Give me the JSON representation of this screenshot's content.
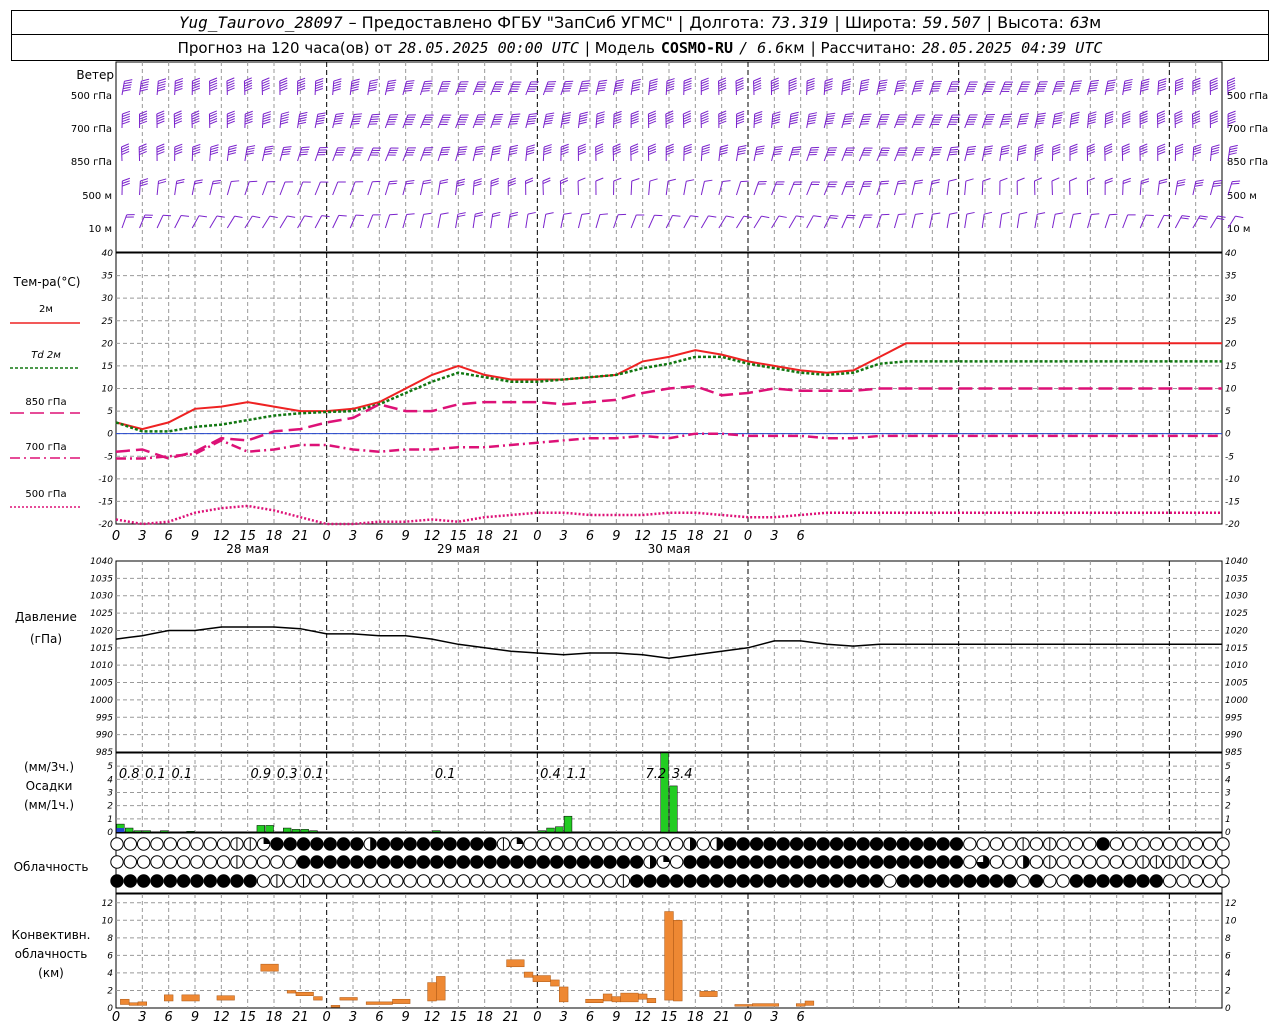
{
  "header": {
    "station": "Yug_Taurovo_28097",
    "provider_text": "– Предоставлено ФГБУ \"ЗапСиб УГМС\" |",
    "lon_label": "Долгота:",
    "lon_value": "73.319",
    "lat_label": "| Широта:",
    "lat_value": "59.507",
    "alt_label": "| Высота:",
    "alt_value": "63",
    "alt_unit": "м",
    "forecast_label": "Прогноз на 120 часа(ов) от",
    "forecast_start": "28.05.2025 00:00 UTC",
    "model_label": "| Модель",
    "model_name": "COSMO-RU",
    "model_res": "/ 6.6",
    "model_res_unit": "км",
    "calc_label": "| Рассчитано:",
    "calc_time": "28.05.2025 04:39 UTC"
  },
  "labels": {
    "wind": "Ветер",
    "wind_levels": [
      "500 гПа",
      "700 гПа",
      "850 гПа",
      "500 м",
      "10 м"
    ],
    "temp_title": "Тем-ра(°С)",
    "temp_series": [
      {
        "name": "2м",
        "color": "#ee2222",
        "dash": ""
      },
      {
        "name": "Td  2м",
        "color": "#117711",
        "dash": "3,2"
      },
      {
        "name": "850 гПа",
        "color": "#dd1177",
        "dash": "14,6"
      },
      {
        "name": "700 гПа",
        "color": "#dd1177",
        "dash": "10,4,2,4"
      },
      {
        "name": "500 гПа",
        "color": "#dd1177",
        "dash": "2,2"
      }
    ],
    "pressure_title": "Давление",
    "pressure_unit": "(гПа)",
    "precip_unit_top": "(мм/3ч.)",
    "precip_title": "Осадки",
    "precip_unit_bottom": "(мм/1ч.)",
    "cloud_title": "Облачность",
    "conv_title_1": "Конвективн.",
    "conv_title_2": "облачность",
    "conv_unit": "(км)"
  },
  "chart_data": [
    {
      "type": "line",
      "panel": "temperature",
      "x_hours": [
        0,
        3,
        6,
        9,
        12,
        15,
        18,
        21,
        24,
        27,
        30,
        33,
        36,
        39,
        42,
        45,
        48,
        51,
        54,
        57,
        60,
        63,
        66,
        69,
        72,
        75,
        78,
        81,
        84,
        87,
        90,
        93,
        96,
        99,
        102,
        105,
        108,
        111,
        114,
        117,
        120,
        123,
        126
      ],
      "x_tick_labels": [
        "0",
        "3",
        "6",
        "9",
        "12",
        "15",
        "18",
        "21",
        "0",
        "3",
        "6",
        "9",
        "12",
        "15",
        "18",
        "21",
        "0",
        "3",
        "6",
        "9",
        "12",
        "15",
        "18",
        "21",
        "0",
        "3",
        "6"
      ],
      "date_labels": [
        {
          "hour": 15,
          "text": "28 мая"
        },
        {
          "hour": 39,
          "text": "29 мая"
        },
        {
          "hour": 63,
          "text": "30 мая"
        }
      ],
      "ylim": [
        -20,
        40
      ],
      "yticks": [
        -20,
        -15,
        -10,
        -5,
        0,
        5,
        10,
        15,
        20,
        25,
        30,
        35,
        40
      ],
      "series": [
        {
          "name": "2м",
          "values": [
            2.5,
            1.0,
            2.5,
            5.5,
            6.0,
            7.0,
            6.0,
            5.0,
            5.0,
            5.5,
            7.0,
            10.0,
            13.0,
            15.0,
            13.0,
            12.0,
            12.0,
            12.0,
            12.5,
            13.0,
            16.0,
            17.0,
            18.5,
            17.5,
            16.0,
            15.0,
            14.0,
            13.5,
            14.0,
            17.0,
            20.0,
            20.0,
            20.0,
            20.0,
            20.0,
            20.0,
            20.0,
            20.0,
            20.0,
            20.0,
            20.0,
            20.0,
            20.0
          ]
        },
        {
          "name": "Td  2м",
          "values": [
            2.5,
            0.5,
            0.5,
            1.5,
            2.0,
            3.0,
            4.0,
            4.5,
            4.8,
            5.0,
            6.5,
            9.0,
            11.5,
            13.5,
            12.5,
            11.5,
            11.5,
            12.0,
            12.5,
            13.0,
            14.5,
            15.5,
            17.0,
            17.0,
            15.5,
            14.5,
            13.5,
            13.0,
            13.5,
            15.5,
            16.0,
            16.0,
            16.0,
            16.0,
            16.0,
            16.0,
            16.0,
            16.0,
            16.0,
            16.0,
            16.0,
            16.0,
            16.0
          ]
        },
        {
          "name": "850 гПа",
          "values": [
            -4.0,
            -3.5,
            -5.5,
            -4.0,
            -1.0,
            -1.5,
            0.5,
            1.0,
            2.5,
            3.5,
            6.5,
            5.0,
            5.0,
            6.5,
            7.0,
            7.0,
            7.0,
            6.5,
            7.0,
            7.5,
            9.0,
            10.0,
            10.5,
            8.5,
            9.0,
            10.0,
            9.5,
            9.5,
            9.5,
            10.0,
            10.0,
            10.0,
            10.0,
            10.0,
            10.0,
            10.0,
            10.0,
            10.0,
            10.0,
            10.0,
            10.0,
            10.0,
            10.0
          ]
        },
        {
          "name": "700 гПа",
          "values": [
            -5.5,
            -5.5,
            -5.0,
            -4.5,
            -1.5,
            -4.0,
            -3.5,
            -2.5,
            -2.5,
            -3.5,
            -4.0,
            -3.5,
            -3.5,
            -3.0,
            -3.0,
            -2.5,
            -2.0,
            -1.5,
            -1.0,
            -1.0,
            -0.5,
            -1.0,
            0.0,
            0.0,
            -0.5,
            -0.5,
            -0.5,
            -1.0,
            -1.0,
            -0.5,
            -0.5,
            -0.5,
            -0.5,
            -0.5,
            -0.5,
            -0.5,
            -0.5,
            -0.5,
            -0.5,
            -0.5,
            -0.5,
            -0.5,
            -0.5
          ]
        },
        {
          "name": "500 гПа",
          "values": [
            -19.0,
            -20.5,
            -19.5,
            -17.5,
            -16.5,
            -16.0,
            -17.0,
            -18.5,
            -20.5,
            -20.5,
            -19.5,
            -19.5,
            -19.0,
            -19.5,
            -18.5,
            -18.0,
            -17.5,
            -17.5,
            -18.0,
            -18.0,
            -18.0,
            -17.5,
            -17.5,
            -18.0,
            -18.5,
            -18.5,
            -18.0,
            -17.5,
            -17.5,
            -17.5,
            -17.5,
            -17.5,
            -17.5,
            -17.5,
            -17.5,
            -17.5,
            -17.5,
            -17.5,
            -17.5,
            -17.5,
            -17.5,
            -17.5,
            -17.5
          ]
        }
      ]
    },
    {
      "type": "line",
      "panel": "pressure",
      "ylim": [
        985,
        1040
      ],
      "yticks": [
        985,
        990,
        995,
        1000,
        1005,
        1010,
        1015,
        1020,
        1025,
        1030,
        1035,
        1040
      ],
      "series": [
        {
          "name": "Давление",
          "values": [
            1017.5,
            1018.5,
            1020.0,
            1020.0,
            1021.0,
            1021.0,
            1021.0,
            1020.5,
            1019.0,
            1019.0,
            1018.5,
            1018.5,
            1017.5,
            1016.0,
            1015.0,
            1014.0,
            1013.5,
            1013.0,
            1013.5,
            1013.5,
            1013.0,
            1012.0,
            1013.0,
            1014.0,
            1015.0,
            1017.0,
            1017.0,
            1016.0,
            1015.5,
            1016.0,
            1016.0,
            1016.0,
            1016.0,
            1016.0,
            1016.0,
            1016.0,
            1016.0,
            1016.0,
            1016.0,
            1016.0,
            1016.0,
            1016.0,
            1016.0
          ]
        }
      ]
    },
    {
      "type": "bar",
      "panel": "precipitation",
      "ylim": [
        0,
        6
      ],
      "yticks": [
        0,
        1,
        2,
        3,
        4,
        5
      ],
      "bars_hourly": [
        {
          "hour": 0.5,
          "value": 0.6
        },
        {
          "hour": 1.5,
          "value": 0.3
        },
        {
          "hour": 2.5,
          "value": 0.1
        },
        {
          "hour": 3.5,
          "value": 0.1
        },
        {
          "hour": 5.5,
          "value": 0.1
        },
        {
          "hour": 8.5,
          "value": 0.05
        },
        {
          "hour": 16.5,
          "value": 0.5
        },
        {
          "hour": 17.5,
          "value": 0.5
        },
        {
          "hour": 19.5,
          "value": 0.3
        },
        {
          "hour": 20.5,
          "value": 0.2
        },
        {
          "hour": 21.5,
          "value": 0.2
        },
        {
          "hour": 22.5,
          "value": 0.1
        },
        {
          "hour": 36.5,
          "value": 0.1
        },
        {
          "hour": 48.5,
          "value": 0.1
        },
        {
          "hour": 49.5,
          "value": 0.3
        },
        {
          "hour": 50.5,
          "value": 0.4
        },
        {
          "hour": 51.5,
          "value": 1.2
        },
        {
          "hour": 62.5,
          "value": 6.0
        },
        {
          "hour": 63.5,
          "value": 3.5
        }
      ],
      "totals_3h": [
        {
          "hour": 1.5,
          "text": "0.8"
        },
        {
          "hour": 4.5,
          "text": "0.1"
        },
        {
          "hour": 7.5,
          "text": "0.1"
        },
        {
          "hour": 16.5,
          "text": "0.9"
        },
        {
          "hour": 19.5,
          "text": "0.3"
        },
        {
          "hour": 22.5,
          "text": "0.1"
        },
        {
          "hour": 37.5,
          "text": "0.1"
        },
        {
          "hour": 49.5,
          "text": "0.4"
        },
        {
          "hour": 52.5,
          "text": "1.1"
        },
        {
          "hour": 61.5,
          "text": "7.2"
        },
        {
          "hour": 64.5,
          "text": "3.4"
        }
      ]
    },
    {
      "type": "table",
      "panel": "cloudiness",
      "layers": [
        "high",
        "medium",
        "low"
      ],
      "rows_cover_0_8": [
        "000000000112888888848888888881200000000000040488888888888888888800001010008000000000",
        "000000000100008888888888888888888888888842088888888888888888888806004010000001111000",
        "888888888880101000000000000000000000001888888888888888888808888888880800888888800000"
      ]
    },
    {
      "type": "bar",
      "panel": "convective_cloud",
      "ylim": [
        0,
        13
      ],
      "yticks": [
        0,
        2,
        4,
        6,
        8,
        10,
        12
      ],
      "bars": [
        {
          "from": 0.5,
          "to": 1.5,
          "top": 1.0,
          "base": 0.4
        },
        {
          "from": 1.5,
          "to": 2.5,
          "top": 0.6,
          "base": 0.3
        },
        {
          "from": 2.5,
          "to": 3.5,
          "top": 0.7,
          "base": 0.3
        },
        {
          "from": 5.5,
          "to": 6.5,
          "top": 1.5,
          "base": 0.8
        },
        {
          "from": 7.5,
          "to": 9.5,
          "top": 1.5,
          "base": 0.8
        },
        {
          "from": 11.5,
          "to": 13.5,
          "top": 1.4,
          "base": 0.9
        },
        {
          "from": 16.5,
          "to": 18.5,
          "top": 5.0,
          "base": 4.2
        },
        {
          "from": 19.5,
          "to": 20.5,
          "top": 2.0,
          "base": 1.7
        },
        {
          "from": 20.5,
          "to": 22.5,
          "top": 1.8,
          "base": 1.4
        },
        {
          "from": 22.5,
          "to": 23.5,
          "top": 1.3,
          "base": 0.9
        },
        {
          "from": 24.5,
          "to": 25.5,
          "top": 0.3,
          "base": 0.1
        },
        {
          "from": 25.5,
          "to": 27.5,
          "top": 1.2,
          "base": 0.9
        },
        {
          "from": 28.5,
          "to": 31.5,
          "top": 0.7,
          "base": 0.4
        },
        {
          "from": 31.5,
          "to": 33.5,
          "top": 1.0,
          "base": 0.5
        },
        {
          "from": 35.5,
          "to": 36.5,
          "top": 2.9,
          "base": 0.8
        },
        {
          "from": 36.5,
          "to": 37.5,
          "top": 3.6,
          "base": 0.9
        },
        {
          "from": 44.5,
          "to": 46.5,
          "top": 5.5,
          "base": 4.7
        },
        {
          "from": 46.5,
          "to": 47.5,
          "top": 4.1,
          "base": 3.5
        },
        {
          "from": 47.5,
          "to": 49.5,
          "top": 3.7,
          "base": 3.0
        },
        {
          "from": 49.5,
          "to": 50.5,
          "top": 3.2,
          "base": 2.5
        },
        {
          "from": 50.5,
          "to": 51.5,
          "top": 2.4,
          "base": 0.7
        },
        {
          "from": 53.5,
          "to": 55.5,
          "top": 1.0,
          "base": 0.6
        },
        {
          "from": 55.5,
          "to": 56.5,
          "top": 1.6,
          "base": 0.8
        },
        {
          "from": 56.5,
          "to": 57.5,
          "top": 1.3,
          "base": 0.7
        },
        {
          "from": 57.5,
          "to": 59.5,
          "top": 1.7,
          "base": 0.7
        },
        {
          "from": 59.5,
          "to": 60.5,
          "top": 1.6,
          "base": 1.0
        },
        {
          "from": 60.5,
          "to": 61.5,
          "top": 1.1,
          "base": 0.6
        },
        {
          "from": 62.5,
          "to": 63.5,
          "top": 11.0,
          "base": 0.9
        },
        {
          "from": 63.5,
          "to": 64.5,
          "top": 10.0,
          "base": 0.8
        },
        {
          "from": 66.5,
          "to": 68.5,
          "top": 1.9,
          "base": 1.3
        },
        {
          "from": 70.5,
          "to": 72.5,
          "top": 0.4,
          "base": 0.2
        },
        {
          "from": 72.5,
          "to": 75.5,
          "top": 0.5,
          "base": 0.2
        },
        {
          "from": 77.5,
          "to": 78.5,
          "top": 0.5,
          "base": 0.2
        },
        {
          "from": 78.5,
          "to": 79.5,
          "top": 0.8,
          "base": 0.3
        }
      ]
    },
    {
      "type": "scatter",
      "panel": "wind_barbs",
      "levels": [
        "500 гПа",
        "700 гПа",
        "850 гПа",
        "500 м",
        "10 м"
      ],
      "color": "#7a22cc"
    }
  ]
}
